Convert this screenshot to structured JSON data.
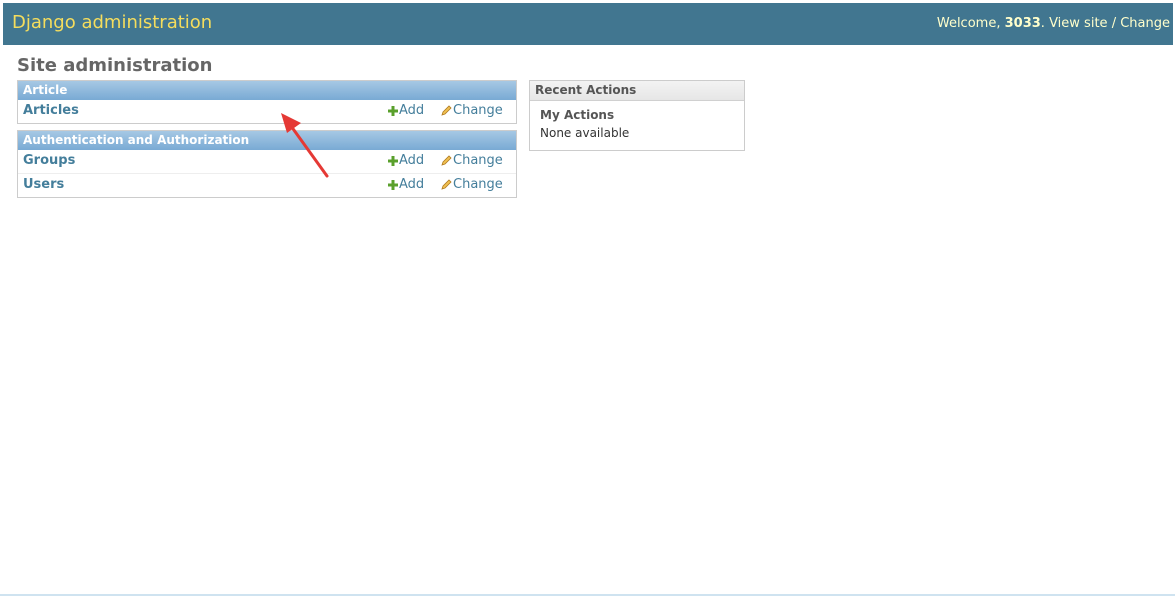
{
  "header": {
    "site_name": "Django administration",
    "welcome_prefix": "Welcome,",
    "username": "3033",
    "view_site": "View site",
    "separator": "/",
    "change_password": "Change"
  },
  "content": {
    "title": "Site administration"
  },
  "apps": [
    {
      "caption": "Article",
      "models": [
        {
          "name": "Articles",
          "add": "Add",
          "change": "Change"
        }
      ]
    },
    {
      "caption": "Authentication and Authorization",
      "models": [
        {
          "name": "Groups",
          "add": "Add",
          "change": "Change"
        },
        {
          "name": "Users",
          "add": "Add",
          "change": "Change"
        }
      ]
    }
  ],
  "recent_actions": {
    "caption": "Recent Actions",
    "my_actions": "My Actions",
    "empty": "None available"
  },
  "icons": {
    "add": "plus-icon",
    "change": "pencil-icon"
  },
  "colors": {
    "header_bg": "#417690",
    "brand": "#f5dd5d",
    "user_tools": "#ffffcc",
    "link": "#447e9b",
    "caption_bg": "#79aad4",
    "annotation": "#e53935"
  }
}
